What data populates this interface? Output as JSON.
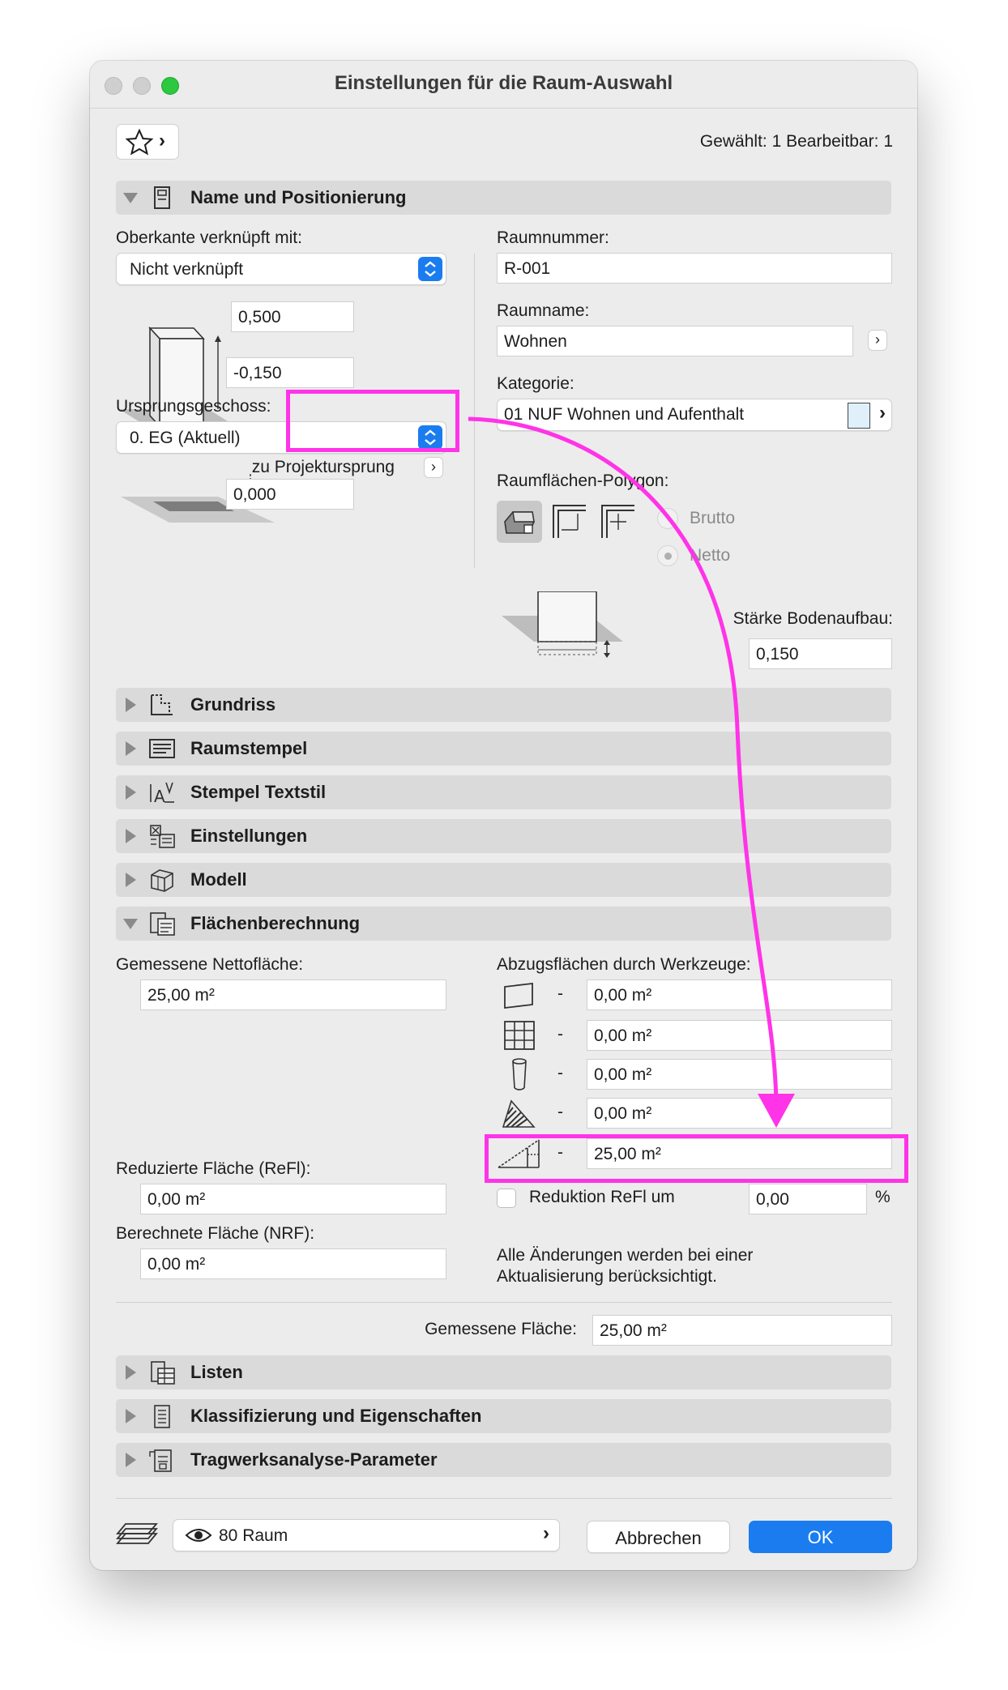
{
  "window": {
    "title": "Einstellungen für die Raum-Auswahl",
    "selection_info": "Gewählt: 1 Bearbeitbar: 1"
  },
  "colors": {
    "accent": "#1b7cf0",
    "annotation": "#ff33e8",
    "close": "#c9c9c9",
    "zoom": "#2bc840"
  },
  "sections": {
    "name": "Name und Positionierung",
    "grundriss": "Grundriss",
    "raumstempel": "Raumstempel",
    "textstil": "Stempel Textstil",
    "einstellungen": "Einstellungen",
    "modell": "Modell",
    "flaechen": "Flächenberechnung",
    "listen": "Listen",
    "klass": "Klassifizierung und Eigenschaften",
    "trag": "Tragwerksanalyse-Parameter"
  },
  "naming": {
    "top_link_label": "Oberkante verknüpft mit:",
    "top_link_value": "Nicht verknüpft",
    "height_value": "0,500",
    "offset_value": "-0,150",
    "origin_label": "Ursprungsgeschoss:",
    "origin_value": "0. EG (Aktuell)",
    "project_origin_label": "zu Projektursprung",
    "project_origin_value": "0,000",
    "room_number_label": "Raumnummer:",
    "room_number_value": "R-001",
    "room_name_label": "Raumname:",
    "room_name_value": "Wohnen",
    "category_label": "Kategorie:",
    "category_value": "01 NUF  Wohnen und Aufenthalt",
    "polygon_label": "Raumflächen-Polygon:",
    "brutto": "Brutto",
    "netto": "Netto",
    "floor_thickness_label": "Stärke Bodenaufbau:",
    "floor_thickness_value": "0,150"
  },
  "area": {
    "net_label": "Gemessene Nettofläche:",
    "net_value": "25,00 m²",
    "deductions_label": "Abzugsflächen durch Werkzeuge:",
    "deductions": [
      {
        "icon": "wall-icon",
        "dash": "-",
        "value": "0,00 m²"
      },
      {
        "icon": "grid-icon",
        "dash": "-",
        "value": "0,00 m²"
      },
      {
        "icon": "column-icon",
        "dash": "-",
        "value": "0,00 m²"
      },
      {
        "icon": "hatch-icon",
        "dash": "-",
        "value": "0,00 m²"
      },
      {
        "icon": "slope-icon",
        "dash": "-",
        "value": "25,00 m²"
      }
    ],
    "reduced_label": "Reduzierte Fläche (ReFl):",
    "reduced_value": "0,00 m²",
    "calc_label": "Berechnete Fläche (NRF):",
    "calc_value": "0,00 m²",
    "reduction_checkbox_label": "Reduktion ReFl um",
    "reduction_value": "0,00",
    "percent": "%",
    "note_line1": "Alle Änderungen werden bei einer",
    "note_line2": "Aktualisierung berücksichtigt.",
    "measured_label": "Gemessene Fläche:",
    "measured_value": "25,00 m²"
  },
  "footer": {
    "layer_value": "80 Raum",
    "cancel": "Abbrechen",
    "ok": "OK"
  },
  "glyphs": {
    "chevron": "›",
    "dropdown": "⌃"
  }
}
